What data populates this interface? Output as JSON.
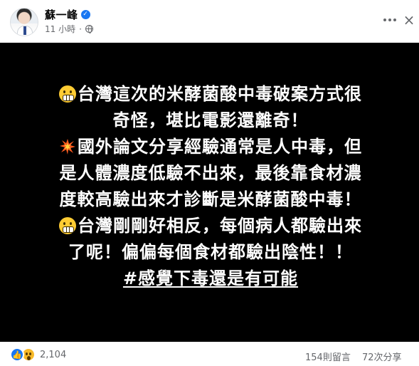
{
  "post": {
    "author": {
      "name": "蘇一峰",
      "verified": true,
      "icon": "verified-badge-icon"
    },
    "meta": {
      "time": "11 小時",
      "separator": "·",
      "privacy_icon": "globe-icon"
    },
    "header_actions": {
      "more_icon": "more-horizontal-icon",
      "close_label": "×"
    },
    "card": {
      "background": "#000000",
      "text_color": "#ffffff",
      "lines": [
        {
          "emoji": "grimace-emoji",
          "text": "台灣這次的米酵菌酸中毒破案方式很"
        },
        {
          "emoji": "",
          "text": "奇怪，堪比電影還離奇！"
        },
        {
          "emoji": "collision-emoji",
          "text": "國外論文分享經驗通常是人中毒，但"
        },
        {
          "emoji": "",
          "text": "是人體濃度低驗不出來，最後靠食材濃"
        },
        {
          "emoji": "",
          "text": "度較高驗出來才診斷是米酵菌酸中毒！"
        },
        {
          "emoji": "grimace-emoji",
          "text": "台灣剛剛好相反，每個病人都驗出來"
        },
        {
          "emoji": "",
          "text": "了呢！偏偏每個食材都驗出陰性！！"
        },
        {
          "emoji": "",
          "text": "#感覺下毒還是有可能"
        }
      ]
    },
    "footer": {
      "reactions": [
        "like-icon",
        "wow-icon"
      ],
      "reaction_count": "2,104",
      "comments": "154則留言",
      "shares": "72次分享",
      "colors": {
        "like": "#1877f2",
        "wow": "#f7b928",
        "muted": "#65676b"
      }
    }
  }
}
